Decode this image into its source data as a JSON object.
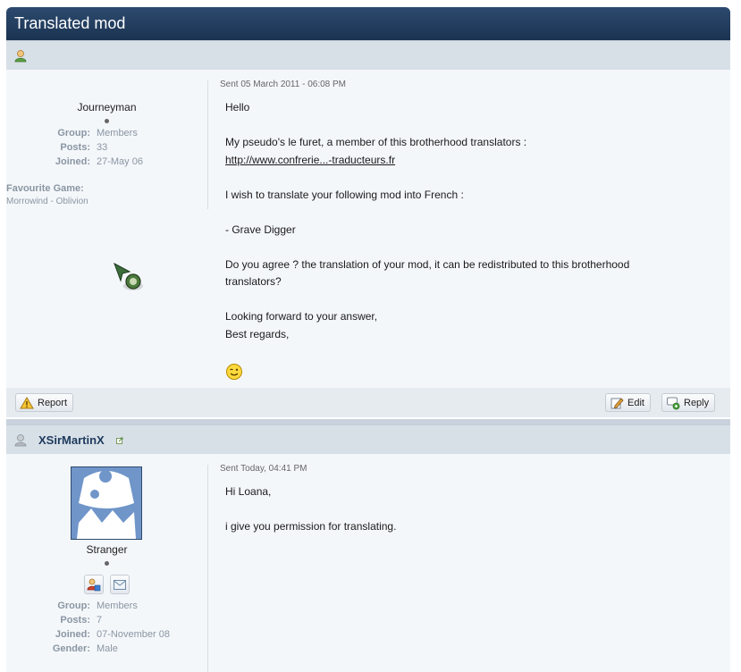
{
  "topic": {
    "title": "Translated mod"
  },
  "post1": {
    "author_rank": "Journeyman",
    "info": [
      {
        "label": "Group:",
        "value": "Members"
      },
      {
        "label": "Posts:",
        "value": "33"
      },
      {
        "label": "Joined:",
        "value": "27-May 06"
      }
    ],
    "favourite_label": "Favourite Game:",
    "favourite_value": "Morrowind - Oblivion",
    "date": "Sent 05 March 2011 - 06:08 PM",
    "lines": {
      "l1": "Hello",
      "l2": "My pseudo's le furet, a member of this brotherhood translators :",
      "link": "http://www.confrerie...-traducteurs.fr",
      "l3": "I wish to translate your following mod into French :",
      "l4": "- Grave Digger",
      "l5": "Do you agree ? the translation of your mod, it can be redistributed to this brotherhood",
      "l6": "translators?",
      "l7": "Looking forward to your answer,",
      "l8": "Best regards,"
    },
    "buttons": {
      "report": "Report",
      "edit": "Edit",
      "reply": "Reply"
    }
  },
  "post2": {
    "username": "XSirMartinX",
    "author_rank": "Stranger",
    "info": [
      {
        "label": "Group:",
        "value": "Members"
      },
      {
        "label": "Posts:",
        "value": "7"
      },
      {
        "label": "Joined:",
        "value": "07-November 08"
      },
      {
        "label": "Gender:",
        "value": "Male"
      }
    ],
    "date": "Sent Today, 04:41 PM",
    "lines": {
      "l1": "Hi Loana,",
      "l2": "i give you permission for translating."
    }
  },
  "icons": {
    "user_online": "user-icon",
    "user_offline": "user-offline-icon",
    "report": "warning-icon",
    "edit": "edit-icon",
    "reply": "reply-icon",
    "smiley": "wink-smiley-icon",
    "profile": "profile-card-icon",
    "message": "envelope-icon",
    "external": "external-link-icon"
  },
  "colors": {
    "title_bar": "#1b3352",
    "header": "#d7dfe7",
    "body": "#f4f7fa",
    "username": "#1d3a5c"
  }
}
